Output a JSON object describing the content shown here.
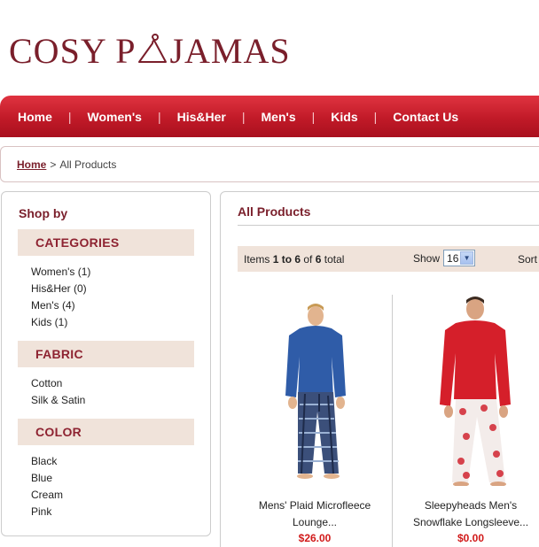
{
  "logo": {
    "text_before": "COSY P",
    "text_after": "JAMAS"
  },
  "nav": [
    {
      "label": "Home"
    },
    {
      "label": "Women's"
    },
    {
      "label": "His&Her"
    },
    {
      "label": "Men's"
    },
    {
      "label": "Kids"
    },
    {
      "label": "Contact Us"
    }
  ],
  "nav_separator": "|",
  "breadcrumb": {
    "home": "Home",
    "separator": ">",
    "current": "All Products"
  },
  "sidebar": {
    "title": "Shop by",
    "sections": [
      {
        "heading": "CATEGORIES",
        "items": [
          "Women's (1)",
          "His&Her (0)",
          "Men's (4)",
          "Kids (1)"
        ]
      },
      {
        "heading": "FABRIC",
        "items": [
          "Cotton",
          "Silk & Satin"
        ]
      },
      {
        "heading": "COLOR",
        "items": [
          "Black",
          "Blue",
          "Cream",
          "Pink"
        ]
      }
    ]
  },
  "main": {
    "title": "All Products",
    "toolbar": {
      "items_prefix": "Items",
      "range": "1 to 6",
      "of": "of",
      "total": "6",
      "total_suffix": "total",
      "show_label": "Show",
      "show_value": "16",
      "sort_label": "Sort"
    },
    "products": [
      {
        "name_line1": "Mens' Plaid Microfleece",
        "name_line2": "Lounge...",
        "price": "$26.00"
      },
      {
        "name_line1": "Sleepyheads Men's",
        "name_line2": "Snowflake Longsleeve...",
        "price": "$0.00"
      }
    ]
  },
  "colors": {
    "brand": "#7a1f2b",
    "nav_red": "#c11a28",
    "panel_beige": "#f0e3da",
    "price_red": "#d11a1a"
  },
  "icons": {
    "logo_hanger": "hanger-icon",
    "select_arrow": "chevron-down-icon"
  }
}
